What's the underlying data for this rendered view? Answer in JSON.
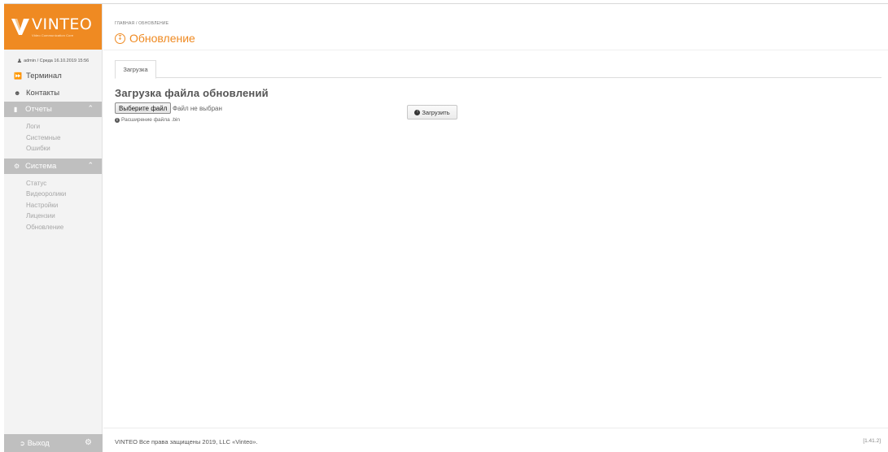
{
  "brand": {
    "name": "VINTEO",
    "tagline": "Video Communication Core",
    "color": "#ef8a22"
  },
  "user": {
    "info": "admin / Среда 16.10.2019 15:56",
    "icon": "user-icon"
  },
  "sidebar": {
    "items": [
      {
        "label": "Терминал",
        "icon": "fast-forward-icon"
      },
      {
        "label": "Контакты",
        "icon": "users-icon"
      }
    ],
    "sections": [
      {
        "label": "Отчеты",
        "icon": "book-icon",
        "items": [
          "Логи",
          "Системные",
          "Ошибки"
        ]
      },
      {
        "label": "Система",
        "icon": "cogs-icon",
        "items": [
          "Статус",
          "Видеоролики",
          "Настройки",
          "Лицензии",
          "Обновление"
        ]
      }
    ],
    "logout_label": "Выход"
  },
  "breadcrumb": {
    "home": "ГЛАВНАЯ",
    "separator": "/",
    "current": "ОБНОВЛЕНИЕ"
  },
  "page": {
    "title": "Обновление",
    "tab": "Загрузка",
    "section_title": "Загрузка файла обновлений",
    "file_button": "Выберите файл",
    "file_status": "Файл не выбран",
    "hint": "Расширение файла .bin",
    "upload_button": "Загрузить"
  },
  "footer": {
    "text": "VINTEO   Все права защищены 2019, LLC «Vinteo».",
    "version": "[1.41.2]"
  }
}
